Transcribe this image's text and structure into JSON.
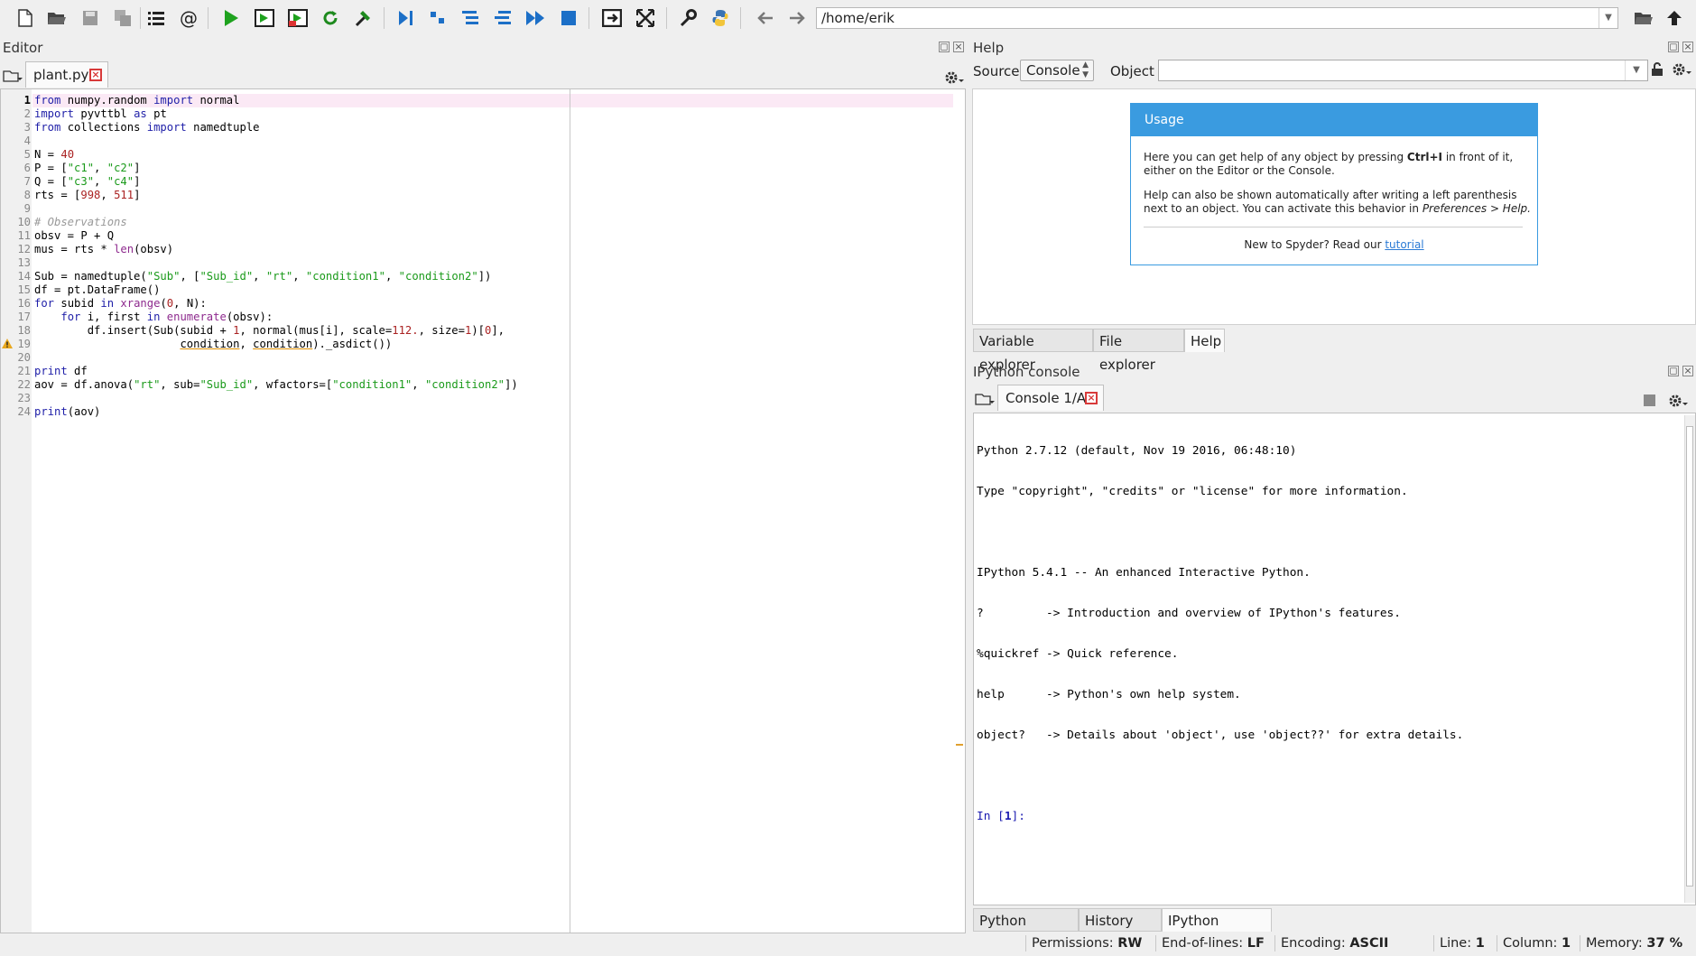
{
  "toolbar": {
    "icons": [
      "new-file-icon",
      "open-file-icon",
      "save-icon",
      "save-all-icon",
      "outline-icon",
      "at-icon",
      "run-icon",
      "run-cell-icon",
      "run-cell-advance-icon",
      "rerun-icon",
      "run-config-icon",
      "debug-icon",
      "step-icon",
      "step-into-icon",
      "step-return-icon",
      "continue-icon",
      "stop-debug-icon",
      "maximize-pane-icon",
      "fullscreen-icon",
      "preferences-icon",
      "python-path-icon",
      "back-icon",
      "forward-icon"
    ],
    "path": "/home/erik"
  },
  "editor": {
    "title": "Editor",
    "tab_label": "plant.py",
    "line_numbers": [
      "1",
      "2",
      "3",
      "4",
      "5",
      "6",
      "7",
      "8",
      "9",
      "10",
      "11",
      "12",
      "13",
      "14",
      "15",
      "16",
      "17",
      "18",
      "19",
      "20",
      "21",
      "22",
      "23",
      "24"
    ],
    "warning_line": "19"
  },
  "help": {
    "title": "Help",
    "source_label": "Source",
    "source_value": "Console",
    "object_label": "Object",
    "object_value": "",
    "usage_title": "Usage",
    "usage_p1_a": "Here you can get help of any object by pressing ",
    "usage_p1_key": "Ctrl+I",
    "usage_p1_b": " in front of it,",
    "usage_p1_c": "either on the Editor or the Console.",
    "usage_p2_a": "Help can also be shown automatically after writing a left parenthesis",
    "usage_p2_b": "next to an object. You can activate this behavior in ",
    "usage_p2_pref": "Preferences > Help.",
    "usage_new": "New to Spyder? Read our ",
    "usage_link": "tutorial",
    "tabs": [
      "Variable explorer",
      "File explorer",
      "Help"
    ]
  },
  "console": {
    "title": "IPython console",
    "tab_label": "Console 1/A",
    "lines": [
      "Python 2.7.12 (default, Nov 19 2016, 06:48:10)",
      "Type \"copyright\", \"credits\" or \"license\" for more information.",
      "",
      "IPython 5.4.1 -- An enhanced Interactive Python.",
      "?         -> Introduction and overview of IPython's features.",
      "%quickref -> Quick reference.",
      "help      -> Python's own help system.",
      "object?   -> Details about 'object', use 'object??' for extra details.",
      ""
    ],
    "prompt_in": "In [",
    "prompt_num": "1",
    "prompt_end": "]:",
    "tabs": [
      "Python console",
      "History log",
      "IPython console"
    ]
  },
  "statusbar": {
    "permissions_label": "Permissions:",
    "permissions_value": "RW",
    "eol_label": "End-of-lines:",
    "eol_value": "LF",
    "encoding_label": "Encoding:",
    "encoding_value": "ASCII",
    "line_label": "Line:",
    "line_value": "1",
    "column_label": "Column:",
    "column_value": "1",
    "memory_label": "Memory:",
    "memory_value": "37 %"
  },
  "colors": {
    "accent": "#3a9be0",
    "close_red": "#d83a3a",
    "keyword": "#1f1fa8",
    "string": "#1a9a1a"
  }
}
